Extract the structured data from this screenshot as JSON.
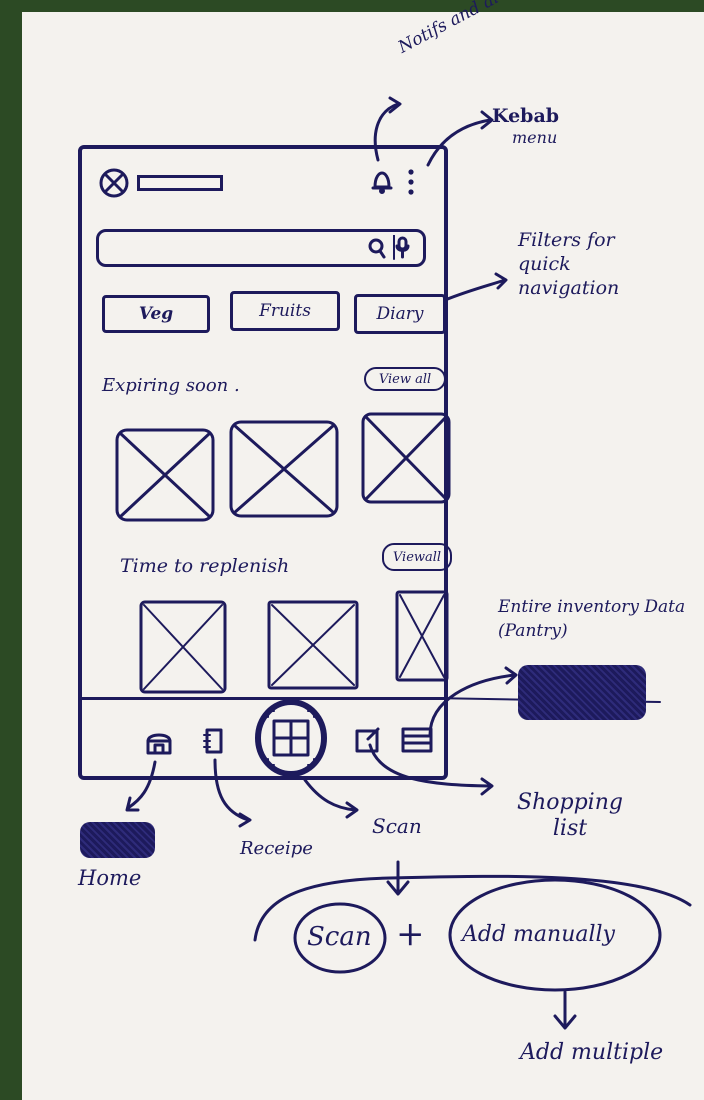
{
  "annotations": {
    "notifs": "Notifs and alerts",
    "kebab_title": "Kebab",
    "kebab_sub": "menu",
    "filters": "Filters for quick navigation",
    "inventory": "Entire inventory Data (Pantry)",
    "home": "Home",
    "receipe": "Receipe",
    "scan": "Scan",
    "shopping": "Shopping list",
    "scan_option": "Scan",
    "plus": "+",
    "add_manually": "Add manually",
    "add_multiple": "Add multiple"
  },
  "filters": [
    "Veg",
    "Fruits",
    "Diary"
  ],
  "sections": {
    "expiring": "Expiring soon .",
    "replenish": "Time to replenish",
    "view_all_1": "View all",
    "view_all_2": "Viewall"
  },
  "icons": [
    "close-icon",
    "bell-icon",
    "kebab-icon",
    "search-icon",
    "mic-icon",
    "home-icon",
    "recipe-icon",
    "scan-icon",
    "shopping-list-icon",
    "pantry-icon"
  ],
  "colors": {
    "ink": "#1d1a5c",
    "paper": "#f4f2ee",
    "background": "#2c4a24"
  }
}
